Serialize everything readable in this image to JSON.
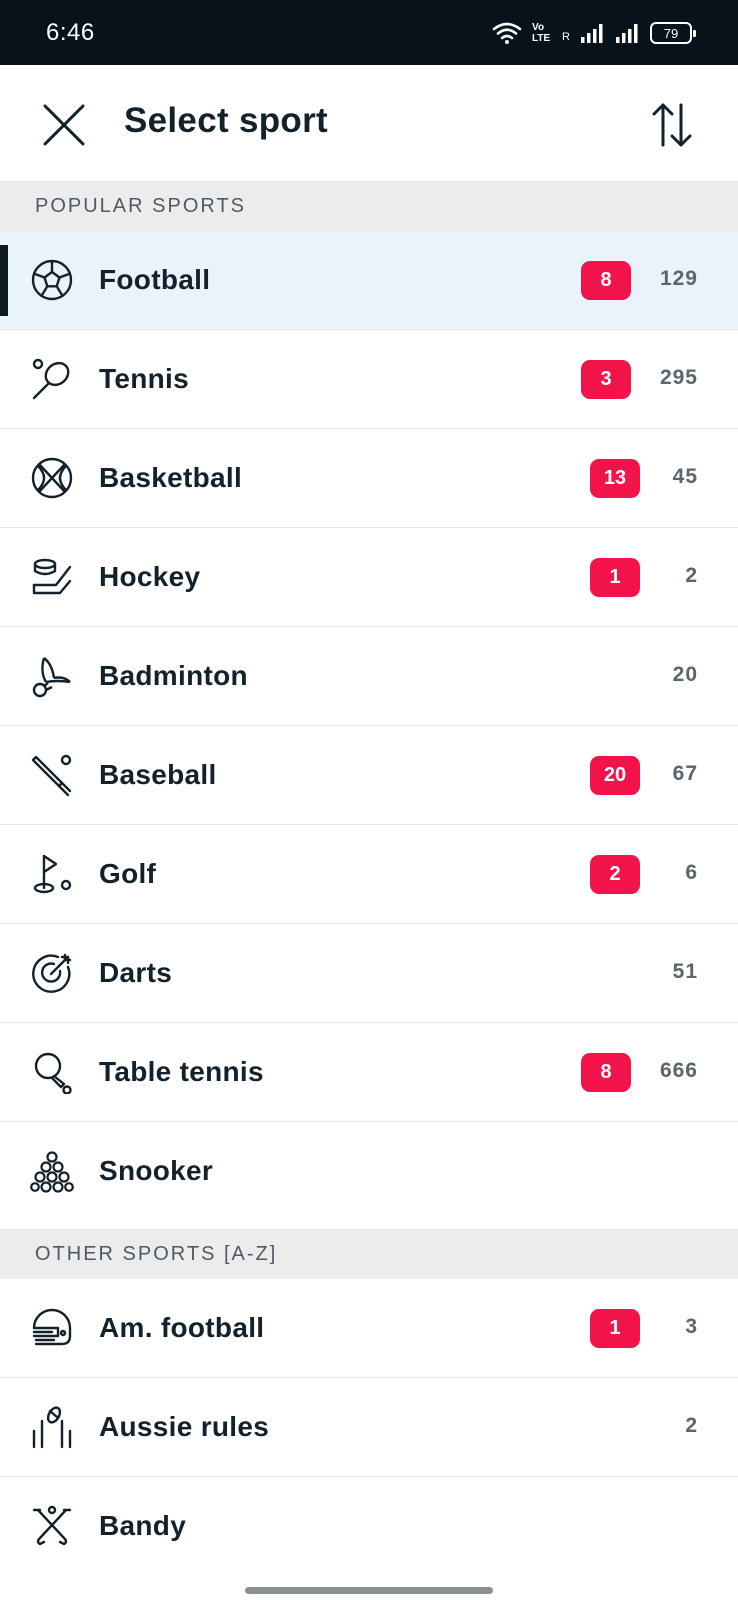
{
  "status_bar": {
    "time": "6:46",
    "volte": "Vo LTE",
    "roaming": "R",
    "battery": "79"
  },
  "header": {
    "title": "Select sport"
  },
  "sections": {
    "popular": "POPULAR SPORTS",
    "other": "OTHER SPORTS [A-Z]"
  },
  "colors": {
    "accent_badge": "#f3134b",
    "selected_row": "#eaf3fc",
    "status_bar": "#08121a"
  },
  "popular_sports": [
    {
      "label": "Football",
      "icon": "football-icon",
      "live": "8",
      "count": "129"
    },
    {
      "label": "Tennis",
      "icon": "tennis-icon",
      "live": "3",
      "count": "295"
    },
    {
      "label": "Basketball",
      "icon": "basketball-icon",
      "live": "13",
      "count": "45"
    },
    {
      "label": "Hockey",
      "icon": "hockey-icon",
      "live": "1",
      "count": "2"
    },
    {
      "label": "Badminton",
      "icon": "badminton-icon",
      "live": "",
      "count": "20"
    },
    {
      "label": "Baseball",
      "icon": "baseball-icon",
      "live": "20",
      "count": "67"
    },
    {
      "label": "Golf",
      "icon": "golf-icon",
      "live": "2",
      "count": "6"
    },
    {
      "label": "Darts",
      "icon": "darts-icon",
      "live": "",
      "count": "51"
    },
    {
      "label": "Table tennis",
      "icon": "table-tennis-icon",
      "live": "8",
      "count": "666"
    },
    {
      "label": "Snooker",
      "icon": "snooker-icon",
      "live": "",
      "count": ""
    }
  ],
  "other_sports": [
    {
      "label": "Am. football",
      "icon": "american-football-icon",
      "live": "1",
      "count": "3"
    },
    {
      "label": "Aussie rules",
      "icon": "aussie-rules-icon",
      "live": "",
      "count": "2"
    },
    {
      "label": "Bandy",
      "icon": "bandy-icon",
      "live": "",
      "count": ""
    }
  ]
}
